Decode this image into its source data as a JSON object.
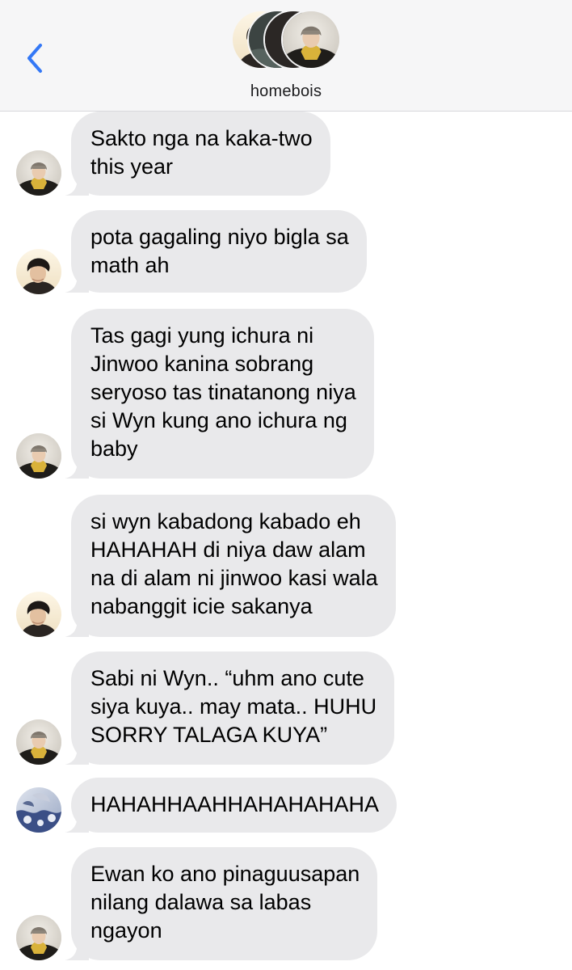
{
  "header": {
    "back_icon": "chevron-left-icon",
    "group_name": "homebois",
    "accent_color": "#3478f6"
  },
  "messages": [
    {
      "sender_avatar": "yellow-hoodie-beanie",
      "lines": [
        "Sakto nga na kaka-two",
        "this year"
      ]
    },
    {
      "sender_avatar": "dark-hair-selfie",
      "lines": [
        "pota gagaling niyo bigla sa",
        "math ah"
      ]
    },
    {
      "sender_avatar": "yellow-hoodie-beanie",
      "lines": [
        "Tas gagi yung ichura ni",
        "Jinwoo kanina sobrang",
        "seryoso tas tinatanong niya",
        "si Wyn kung ano ichura ng",
        "baby"
      ]
    },
    {
      "sender_avatar": "dark-hair-selfie",
      "lines": [
        "si wyn kabadong kabado eh",
        "HAHAHAH di niya daw alam",
        "na di alam ni jinwoo kasi wala",
        "nabanggit icie sakanya"
      ]
    },
    {
      "sender_avatar": "yellow-hoodie-beanie",
      "lines": [
        "Sabi ni Wyn.. “uhm ano cute",
        "siya kuya.. may mata.. HUHU",
        "SORRY TALAGA KUYA”"
      ]
    },
    {
      "sender_avatar": "blue-pattern",
      "lines": [
        "HAHAHHAAHHAHAHAHAHA"
      ]
    },
    {
      "sender_avatar": "yellow-hoodie-beanie",
      "lines": [
        "Ewan ko ano pinaguusapan",
        "nilang dalawa sa labas",
        "ngayon"
      ]
    }
  ],
  "colors": {
    "bubble_received": "#e9e9eb",
    "header_bg": "#f6f6f7"
  }
}
